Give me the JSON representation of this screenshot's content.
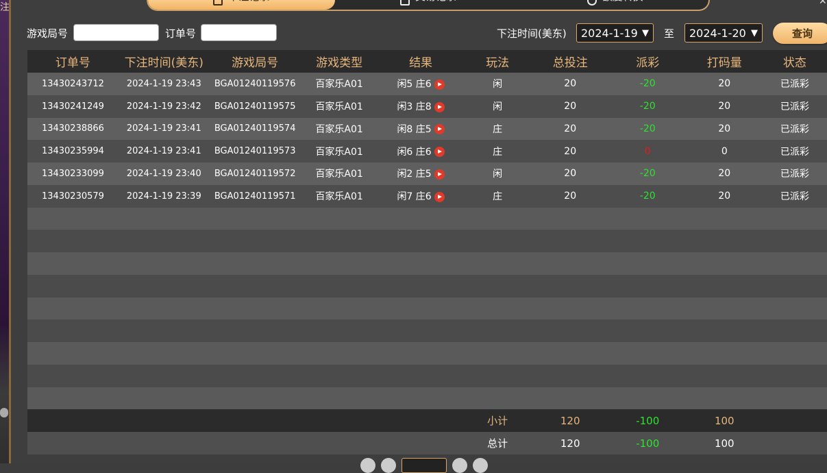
{
  "background": {
    "left_char": "注"
  },
  "tabs": [
    {
      "label": "下注记录",
      "active": true,
      "icon": "list-icon"
    },
    {
      "label": "交易记录",
      "active": false,
      "icon": "doc-icon"
    },
    {
      "label": "额度转换",
      "active": false,
      "icon": "exchange-icon"
    }
  ],
  "close_icon": "✕",
  "filters": {
    "game_round_label": "游戏局号",
    "game_round_value": "",
    "order_label": "订单号",
    "order_value": "",
    "time_label": "下注时间(美东)",
    "date_from": "2024-1-19",
    "to_label": "至",
    "date_to": "2024-1-20",
    "query_label": "查询"
  },
  "table": {
    "headers": [
      "订单号",
      "下注时间(美东)",
      "游戏局号",
      "游戏类型",
      "结果",
      "玩法",
      "总投注",
      "派彩",
      "打码量",
      "状态"
    ],
    "rows": [
      {
        "order": "13430243712",
        "time": "2024-1-19 23:43",
        "round": "BGA01240119576",
        "type": "百家乐A01",
        "result": "闲5 庄6",
        "play": "闲",
        "bet": "20",
        "payout": "-20",
        "payout_color": "green",
        "turnover": "20",
        "status": "已派彩"
      },
      {
        "order": "13430241249",
        "time": "2024-1-19 23:42",
        "round": "BGA01240119575",
        "type": "百家乐A01",
        "result": "闲3 庄8",
        "play": "闲",
        "bet": "20",
        "payout": "-20",
        "payout_color": "green",
        "turnover": "20",
        "status": "已派彩"
      },
      {
        "order": "13430238866",
        "time": "2024-1-19 23:41",
        "round": "BGA01240119574",
        "type": "百家乐A01",
        "result": "闲8 庄5",
        "play": "庄",
        "bet": "20",
        "payout": "-20",
        "payout_color": "green",
        "turnover": "20",
        "status": "已派彩"
      },
      {
        "order": "13430235994",
        "time": "2024-1-19 23:41",
        "round": "BGA01240119573",
        "type": "百家乐A01",
        "result": "闲6 庄6",
        "play": "庄",
        "bet": "20",
        "payout": "0",
        "payout_color": "red",
        "turnover": "0",
        "status": "已派彩"
      },
      {
        "order": "13430233099",
        "time": "2024-1-19 23:40",
        "round": "BGA01240119572",
        "type": "百家乐A01",
        "result": "闲2 庄5",
        "play": "闲",
        "bet": "20",
        "payout": "-20",
        "payout_color": "green",
        "turnover": "20",
        "status": "已派彩"
      },
      {
        "order": "13430230579",
        "time": "2024-1-19 23:39",
        "round": "BGA01240119571",
        "type": "百家乐A01",
        "result": "闲7 庄6",
        "play": "庄",
        "bet": "20",
        "payout": "-20",
        "payout_color": "green",
        "turnover": "20",
        "status": "已派彩"
      }
    ],
    "empty_rows": 9,
    "subtotal": {
      "label": "小计",
      "bet": "120",
      "payout": "-100",
      "turnover": "100"
    },
    "total": {
      "label": "总计",
      "bet": "120",
      "payout": "-100",
      "turnover": "100"
    }
  },
  "colors": {
    "accent": "#e7b67c",
    "positive": "#2fe22f",
    "negative": "#e21b1b"
  }
}
